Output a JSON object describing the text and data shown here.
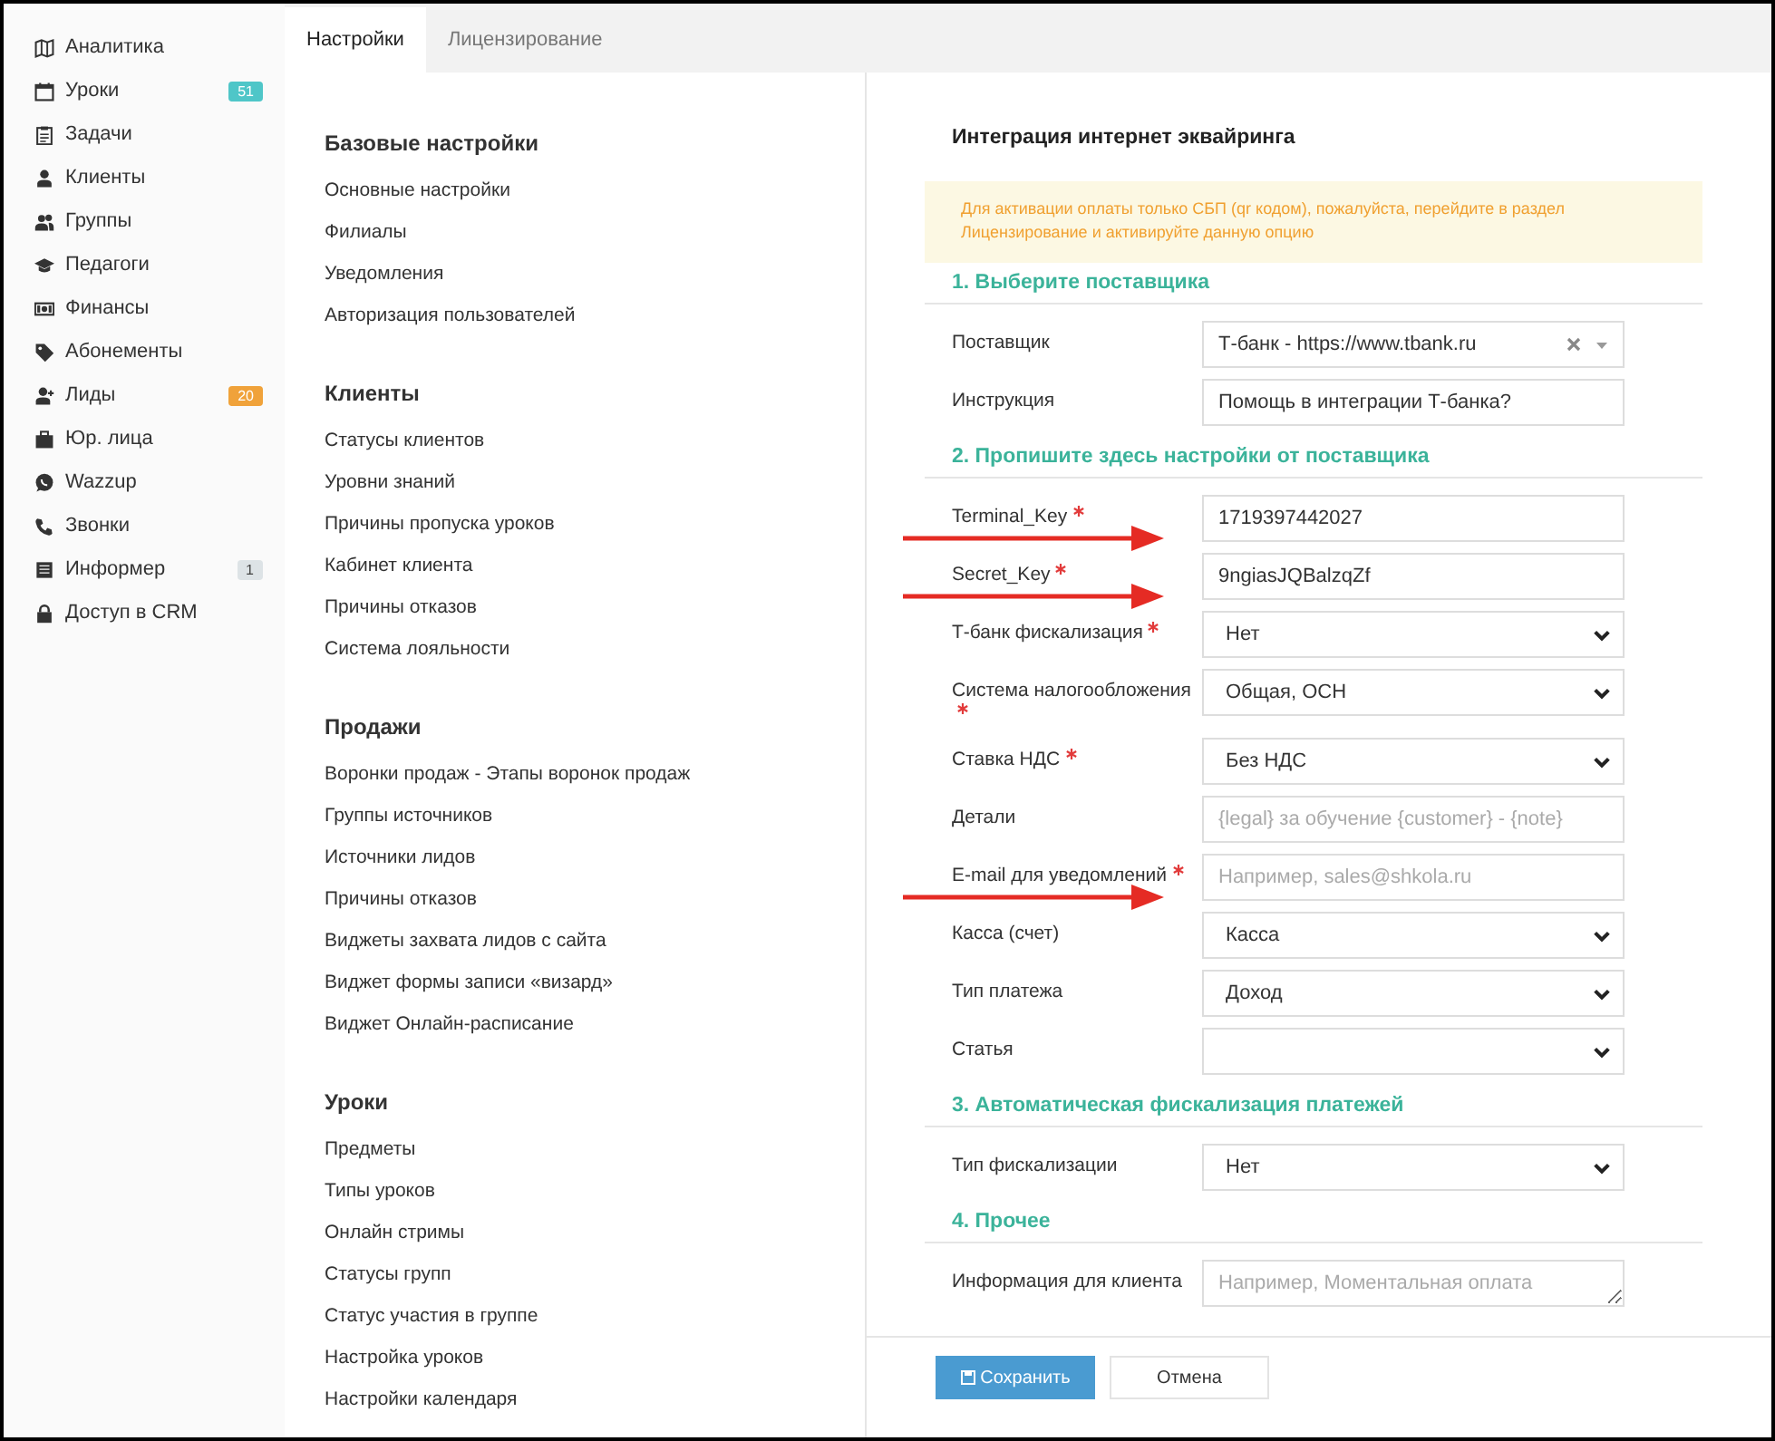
{
  "sidebar": {
    "items": [
      {
        "label": "Аналитика"
      },
      {
        "label": "Уроки",
        "badge": "51",
        "color": "#4fc6c8"
      },
      {
        "label": "Задачи"
      },
      {
        "label": "Клиенты"
      },
      {
        "label": "Группы"
      },
      {
        "label": "Педагоги"
      },
      {
        "label": "Финансы"
      },
      {
        "label": "Абонементы"
      },
      {
        "label": "Лиды",
        "badge": "20",
        "color": "#f0a23a"
      },
      {
        "label": "Юр. лица"
      },
      {
        "label": "Wazzup"
      },
      {
        "label": "Звонки"
      },
      {
        "label": "Информер",
        "badge": "1",
        "color": "#dde3e6"
      },
      {
        "label": "Доступ в CRM"
      }
    ]
  },
  "tabs": [
    {
      "label": "Настройки",
      "selected": true
    },
    {
      "label": "Лицензирование",
      "selected": false
    }
  ],
  "settings_menu": [
    {
      "title": "Базовые настройки",
      "items": [
        "Основные настройки",
        "Филиалы",
        "Уведомления",
        "Авторизация пользователей"
      ]
    },
    {
      "title": "Клиенты",
      "items": [
        "Статусы клиентов",
        "Уровни знаний",
        "Причины пропуска уроков",
        "Кабинет клиента",
        "Причины отказов",
        "Система лояльности"
      ]
    },
    {
      "title": "Продажи",
      "items": [
        "Воронки продаж - Этапы воронок продаж",
        "Группы источников",
        "Источники лидов",
        "Причины отказов",
        "Виджеты захвата лидов с сайта",
        "Виджет формы записи «визард»",
        "Виджет Онлайн-расписание"
      ]
    },
    {
      "title": "Уроки",
      "items": [
        "Предметы",
        "Типы уроков",
        "Онлайн стримы",
        "Статусы групп",
        "Статус участия в группе",
        "Настройка уроков",
        "Настройки календаря"
      ]
    }
  ],
  "form": {
    "title": "Интеграция интернет эквайринга",
    "alert": "Для активации оплаты только СБП (qr кодом), пожалуйста, перейдите в раздел Лицензирование и активируйте данную опцию",
    "sections": [
      {
        "title": "1. Выберите поставщика",
        "fields": [
          {
            "label": "Поставщик",
            "kind": "combo",
            "value": "Т-банк - https://www.tbank.ru",
            "required": false,
            "arrow": false
          },
          {
            "label": "Инструкция",
            "kind": "text",
            "value": "Помощь в интеграции Т-банка?",
            "required": false,
            "arrow": false
          }
        ]
      },
      {
        "title": "2. Пропишите здесь настройки от поставщика",
        "fields": [
          {
            "label": "Terminal_Key",
            "kind": "text",
            "value": "1719397442027",
            "required": true,
            "arrow": true
          },
          {
            "label": "Secret_Key",
            "kind": "text",
            "value": "9ngiasJQBalzqZf",
            "required": true,
            "arrow": true
          },
          {
            "label": "Т-банк фискализация",
            "kind": "select",
            "value": "Нет",
            "required": true,
            "arrow": false
          },
          {
            "label": "Система налогообложения",
            "kind": "select",
            "value": "Общая, ОСН",
            "required": true,
            "arrow": false
          },
          {
            "label": "Ставка НДС",
            "kind": "select",
            "value": "Без НДС",
            "required": true,
            "arrow": false
          },
          {
            "label": "Детали",
            "kind": "text",
            "placeholder": "{legal} за обучение {customer} - {note}",
            "required": false,
            "arrow": false
          },
          {
            "label": "E-mail для уведомлений",
            "kind": "text",
            "placeholder": "Например, sales@shkola.ru",
            "required": true,
            "arrow": true
          },
          {
            "label": "Касса (счет)",
            "kind": "select",
            "value": "Касса",
            "required": false,
            "arrow": false
          },
          {
            "label": "Тип платежа",
            "kind": "select",
            "value": "Доход",
            "required": false,
            "arrow": false
          },
          {
            "label": "Статья",
            "kind": "select",
            "required": false,
            "arrow": false
          }
        ]
      },
      {
        "title": "3. Автоматическая фискализация платежей",
        "fields": [
          {
            "label": "Тип фискализации",
            "kind": "select",
            "value": "Нет",
            "required": false,
            "arrow": false
          }
        ]
      },
      {
        "title": "4. Прочее",
        "fields": [
          {
            "label": "Информация для клиента",
            "kind": "textarea",
            "placeholder": "Например, Моментальная оплата",
            "required": false,
            "arrow": false
          }
        ]
      }
    ],
    "buttons": [
      {
        "label": "Сохранить",
        "kind": "primary"
      },
      {
        "label": "Отмена",
        "kind": "secondary"
      }
    ]
  }
}
